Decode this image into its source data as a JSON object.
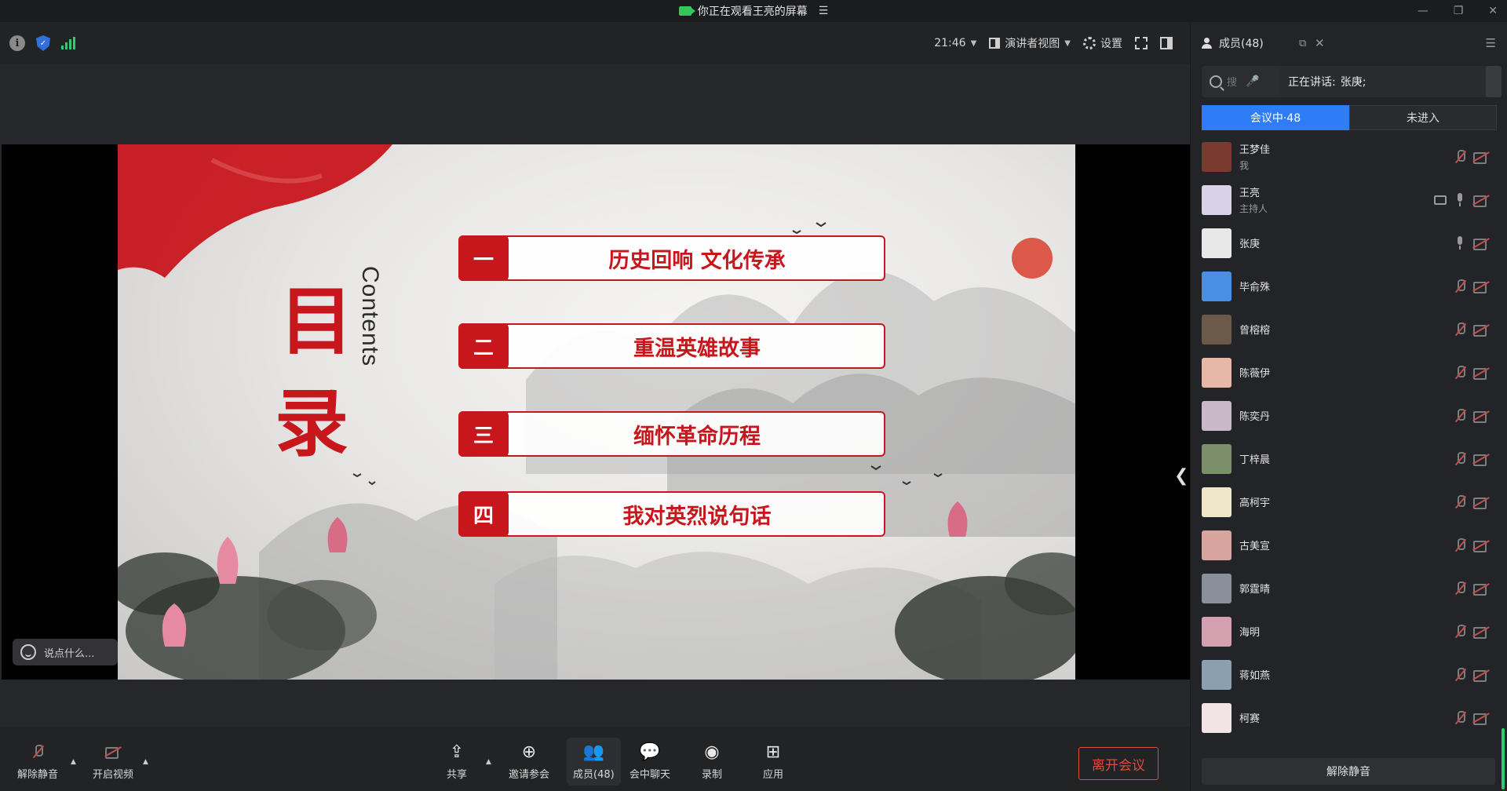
{
  "window": {
    "title": "你正在观看王亮的屏幕",
    "title_menu_icon": "list-icon",
    "controls": [
      "minimize-icon",
      "restore-icon",
      "close-icon"
    ]
  },
  "toolbar": {
    "time": "21:46",
    "view_label": "演讲者视图",
    "settings_label": "设置",
    "icons": [
      "info-icon",
      "shield-icon",
      "signal-icon",
      "fullscreen-icon",
      "side-panel-icon"
    ]
  },
  "slide": {
    "title_char_1": "目",
    "title_char_2": "录",
    "contents_word": "Contents",
    "items": [
      {
        "num": "一",
        "text": "历史回响 文化传承"
      },
      {
        "num": "二",
        "text": "重温英雄故事"
      },
      {
        "num": "三",
        "text": "缅怀革命历程"
      },
      {
        "num": "四",
        "text": "我对英烈说句话"
      }
    ],
    "accent_color": "#c8161d"
  },
  "chat": {
    "placeholder": "说点什么..."
  },
  "bottombar": {
    "buttons": [
      {
        "label": "解除静音",
        "icon": "mic-off-icon"
      },
      {
        "label": "开启视频",
        "icon": "camera-off-icon"
      },
      {
        "label": "共享",
        "icon": "share-screen-icon"
      },
      {
        "label": "邀请参会",
        "icon": "invite-icon"
      },
      {
        "label": "成员(48)",
        "icon": "members-icon"
      },
      {
        "label": "会中聊天",
        "icon": "chat-icon"
      },
      {
        "label": "录制",
        "icon": "record-icon"
      },
      {
        "label": "应用",
        "icon": "apps-icon"
      }
    ],
    "leave_label": "离开会议",
    "leave_color": "#e04a3f"
  },
  "sidebar": {
    "header": "成员(48)",
    "search_placeholder": "搜",
    "speaking_label": "正在讲话:",
    "speaking_name": "张庚;",
    "tab_in_meeting": "会议中·48",
    "tab_not_joined": "未进入",
    "active_tab_color": "#2e7cf6",
    "members": [
      {
        "name": "王梦佳",
        "role": "我",
        "mic": "off",
        "avatar_color": "#7a3b2e"
      },
      {
        "name": "王亮",
        "role": "主持人",
        "mic": "on",
        "screen": true,
        "avatar_color": "#d9d2e6"
      },
      {
        "name": "张庚",
        "role": "",
        "mic": "on",
        "avatar_color": "#e8e8e8"
      },
      {
        "name": "毕俞殊",
        "role": "",
        "mic": "off",
        "avatar_color": "#4a90e2"
      },
      {
        "name": "曾榕榕",
        "role": "",
        "mic": "off",
        "avatar_color": "#6b5a4a"
      },
      {
        "name": "陈薇伊",
        "role": "",
        "mic": "off",
        "avatar_color": "#e7b8a8"
      },
      {
        "name": "陈奕丹",
        "role": "",
        "mic": "off",
        "avatar_color": "#c9b8c8"
      },
      {
        "name": "丁梓晨",
        "role": "",
        "mic": "off",
        "avatar_color": "#7a8f6a"
      },
      {
        "name": "高柯宇",
        "role": "",
        "mic": "off",
        "avatar_color": "#f0e6c8"
      },
      {
        "name": "古美宣",
        "role": "",
        "mic": "off",
        "avatar_color": "#d8a4a0"
      },
      {
        "name": "郭霆晴",
        "role": "",
        "mic": "off",
        "avatar_color": "#8a8f9a"
      },
      {
        "name": "海明",
        "role": "",
        "mic": "off",
        "avatar_color": "#d4a0b0"
      },
      {
        "name": "蒋如燕",
        "role": "",
        "mic": "off",
        "avatar_color": "#8aa0b0"
      },
      {
        "name": "柯赛",
        "role": "",
        "mic": "off",
        "avatar_color": "#f2e4e4"
      }
    ],
    "unmute_all_label": "解除静音"
  }
}
